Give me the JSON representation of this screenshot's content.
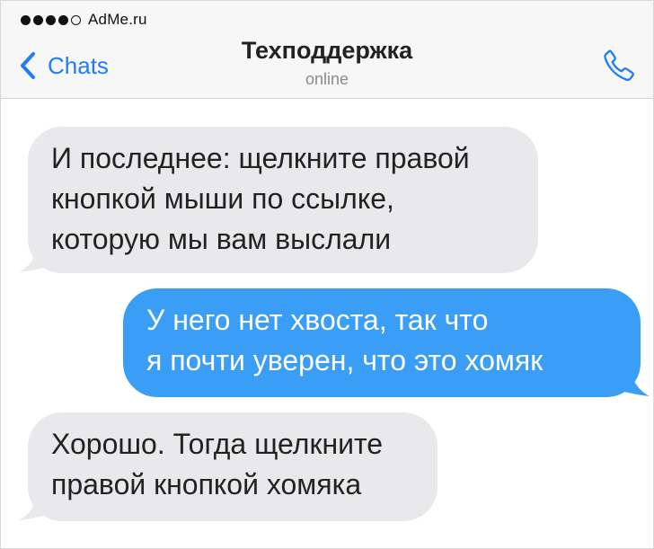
{
  "status_bar": {
    "carrier": "AdMe.ru",
    "signal_filled": 4,
    "signal_total": 5
  },
  "nav": {
    "back_label": "Chats",
    "title": "Техподдержка",
    "subtitle": "online"
  },
  "messages": [
    {
      "direction": "incoming",
      "lines": [
        "И последнее: щелкните правой",
        "кнопкой мыши по ссылке,",
        "которую мы вам выслали"
      ]
    },
    {
      "direction": "outgoing",
      "lines": [
        "У него нет хвоста, так что",
        "я почти уверен, что это хомяк"
      ]
    },
    {
      "direction": "incoming",
      "lines": [
        "Хорошо. Тогда щелкните",
        "правой кнопкой хомяка"
      ]
    }
  ],
  "colors": {
    "accent": "#1f7ef5",
    "incoming_bubble": "#e9e9ec",
    "outgoing_bubble": "#3b9ef6"
  },
  "icons": {
    "back": "chevron-left-icon",
    "call": "phone-icon"
  }
}
